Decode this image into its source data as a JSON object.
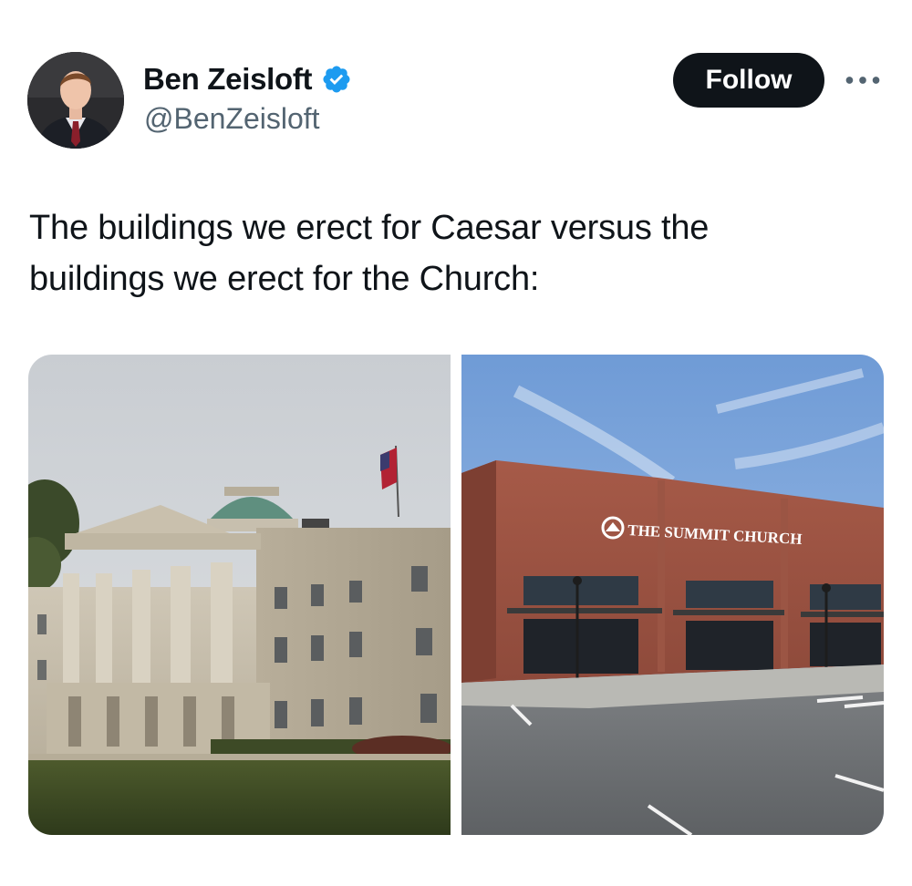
{
  "user": {
    "display_name": "Ben Zeisloft",
    "handle": "@BenZeisloft",
    "verified": true,
    "avatar_icon": "profile-photo"
  },
  "actions": {
    "follow_label": "Follow",
    "more_icon": "more-horizontal-icon"
  },
  "tweet": {
    "text": "The buildings we erect for Caesar versus the buildings we erect for the Church:"
  },
  "media": {
    "right_sign_text": "THE SUMMIT CHURCH"
  },
  "colors": {
    "text_primary": "#0f1419",
    "text_secondary": "#536471",
    "verified_blue": "#1d9bf0",
    "follow_bg": "#0f1419",
    "follow_text": "#ffffff"
  }
}
